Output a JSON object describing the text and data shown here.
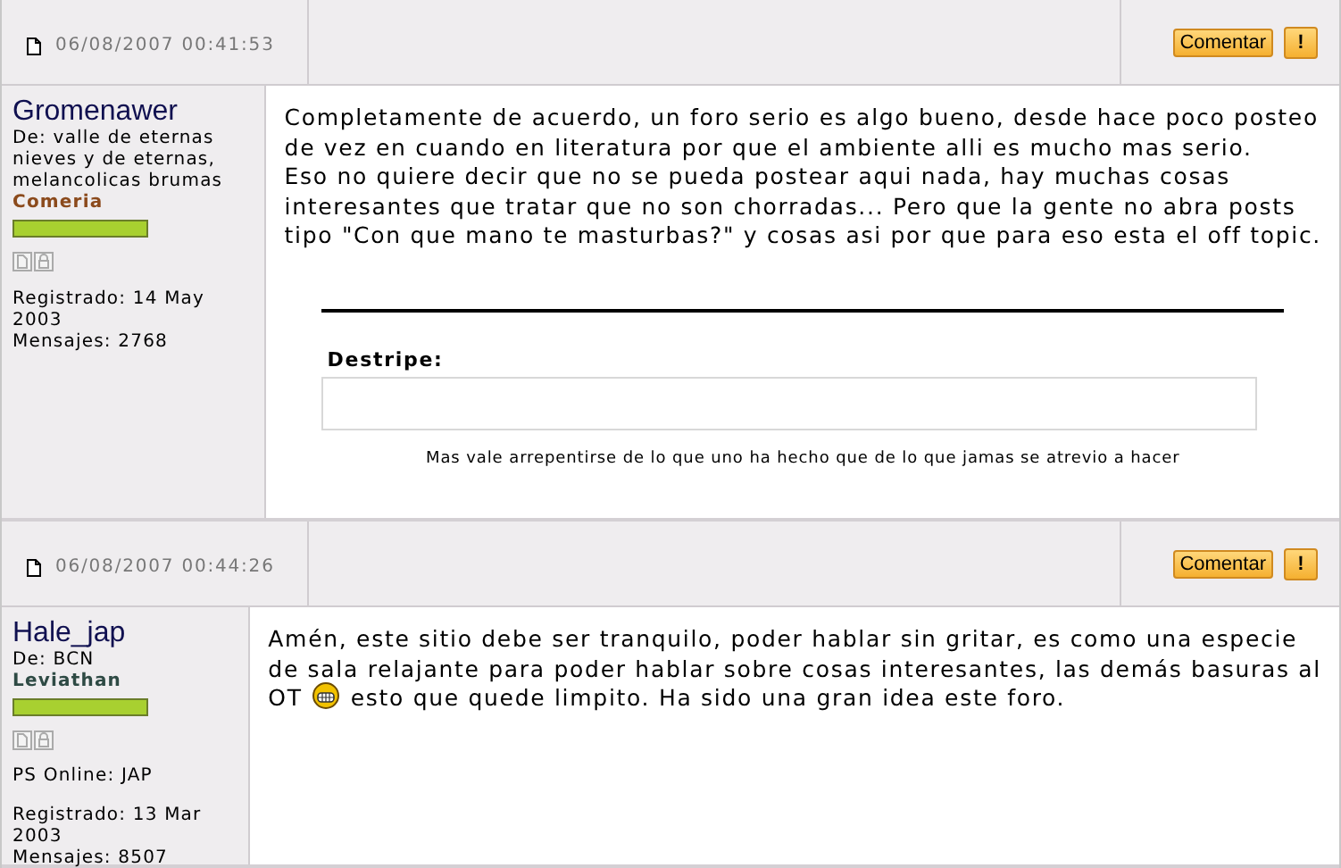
{
  "posts": [
    {
      "date": "06/08/2007 00:41:53",
      "author": {
        "name": "Gromenawer",
        "location": "De: valle de eternas nieves y de eternas, melancolicas brumas",
        "rank": "Comeria",
        "color": "#8b4a1c",
        "level": 1,
        "registered": "Registrado: 14 May 2003",
        "messages": "Mensajes: 2768"
      },
      "buttons": {
        "comment": "Comentar",
        "report": "!"
      },
      "message": [
        [
          {
            "kind": "text",
            "text": "Completamente de acuerdo, un foro serio es algo bueno, desde hace poco posteo"
          }
        ],
        [
          {
            "kind": "text",
            "text": "de vez en cuando en literatura por que el ambiente alli es mucho mas serio."
          }
        ],
        [
          {
            "kind": "text",
            "text": "Eso no quiere decir que no se pueda postear aqui nada, hay muchas cosas"
          }
        ],
        [
          {
            "kind": "text",
            "text": "interesantes que tratar que no son chorradas... Pero que la gente no abra posts"
          }
        ],
        [
          {
            "kind": "text",
            "text": "tipo \"Con que mano te masturbas?\" y cosas asi por que para eso esta el off topic."
          }
        ]
      ],
      "signature": {
        "spoiler_label": "Destripe:",
        "text": "Mas vale arrepentirse de lo que uno ha hecho que de lo que jamas se atrevio a hacer"
      }
    },
    {
      "date": "06/08/2007 00:44:26",
      "author": {
        "name": "Hale_jap",
        "location": "De: BCN",
        "rank": "Leviathan",
        "color": "#2e4a44",
        "level": 1,
        "extra": [
          "PS Online: JAP"
        ],
        "registered": "Registrado: 13 Mar 2003",
        "messages": "Mensajes: 8507"
      },
      "buttons": {
        "comment": "Comentar",
        "report": "!"
      },
      "message": [
        [
          {
            "kind": "text",
            "text": "Amén, este sitio debe ser tranquilo, poder hablar sin gritar, es como una especie"
          }
        ],
        [
          {
            "kind": "text",
            "text": "de sala relajante para poder hablar sobre cosas interesantes, las demás basuras al"
          }
        ],
        [
          {
            "kind": "text",
            "text": "OT"
          },
          {
            "kind": "smiley"
          },
          {
            "kind": "text",
            "text": "esto que quede limpito. Ha sido una gran idea este foro."
          }
        ]
      ]
    }
  ]
}
